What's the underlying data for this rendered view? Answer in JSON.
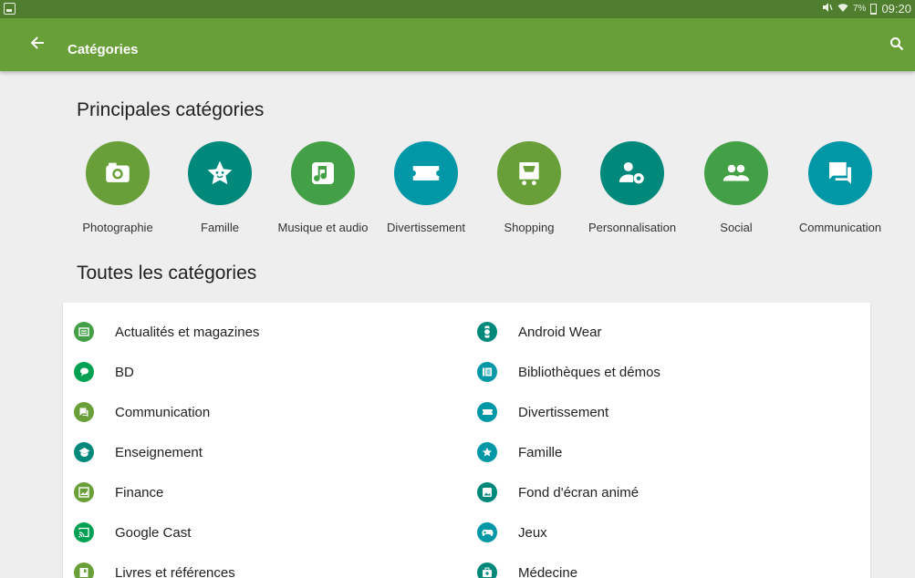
{
  "colors": {
    "status_bar": "#4f7f2e",
    "app_bar": "#689f38",
    "green": "#689f38",
    "teal": "#00897b",
    "deep_teal": "#0097a7",
    "background": "#eeeeee"
  },
  "status_bar": {
    "battery": "7%",
    "time": "09:20",
    "icons": [
      "screenshot-icon",
      "mute-icon",
      "wifi-icon",
      "battery-icon"
    ]
  },
  "app_bar": {
    "title": "Catégories",
    "back_icon": "arrow-left-icon",
    "search_icon": "search-icon"
  },
  "top_section": {
    "heading": "Principales catégories",
    "items": [
      {
        "label": "Photographie",
        "icon": "camera-icon",
        "color": "#689f38"
      },
      {
        "label": "Famille",
        "icon": "star-face-icon",
        "color": "#00897b"
      },
      {
        "label": "Musique et audio",
        "icon": "music-note-icon",
        "color": "#43a047"
      },
      {
        "label": "Divertissement",
        "icon": "ticket-icon",
        "color": "#0097a7"
      },
      {
        "label": "Shopping",
        "icon": "cart-icon",
        "color": "#689f38"
      },
      {
        "label": "Personnalisation",
        "icon": "person-gear-icon",
        "color": "#00897b"
      },
      {
        "label": "Social",
        "icon": "people-icon",
        "color": "#43a047"
      },
      {
        "label": "Communication",
        "icon": "chat-icon",
        "color": "#0097a7"
      }
    ]
  },
  "all_section": {
    "heading": "Toutes les catégories",
    "left": [
      {
        "label": "Actualités et magazines",
        "icon": "newspaper-icon",
        "color": "#43a047"
      },
      {
        "label": "BD",
        "icon": "speech-bubble-icon",
        "color": "#00a152"
      },
      {
        "label": "Communication",
        "icon": "chat-icon",
        "color": "#689f38"
      },
      {
        "label": "Enseignement",
        "icon": "graduation-cap-icon",
        "color": "#00897b"
      },
      {
        "label": "Finance",
        "icon": "chart-image-icon",
        "color": "#689f38"
      },
      {
        "label": "Google Cast",
        "icon": "cast-icon",
        "color": "#00a152"
      },
      {
        "label": "Livres et références",
        "icon": "book-icon",
        "color": "#689f38"
      }
    ],
    "right": [
      {
        "label": "Android Wear",
        "icon": "watch-icon",
        "color": "#00897b"
      },
      {
        "label": "Bibliothèques et démos",
        "icon": "library-icon",
        "color": "#0097a7"
      },
      {
        "label": "Divertissement",
        "icon": "ticket-icon",
        "color": "#0097a7"
      },
      {
        "label": "Famille",
        "icon": "star-face-icon",
        "color": "#0097a7"
      },
      {
        "label": "Fond d'écran animé",
        "icon": "wallpaper-icon",
        "color": "#00897b"
      },
      {
        "label": "Jeux",
        "icon": "gamepad-icon",
        "color": "#0097a7"
      },
      {
        "label": "Médecine",
        "icon": "medical-bag-icon",
        "color": "#00897b"
      }
    ]
  }
}
